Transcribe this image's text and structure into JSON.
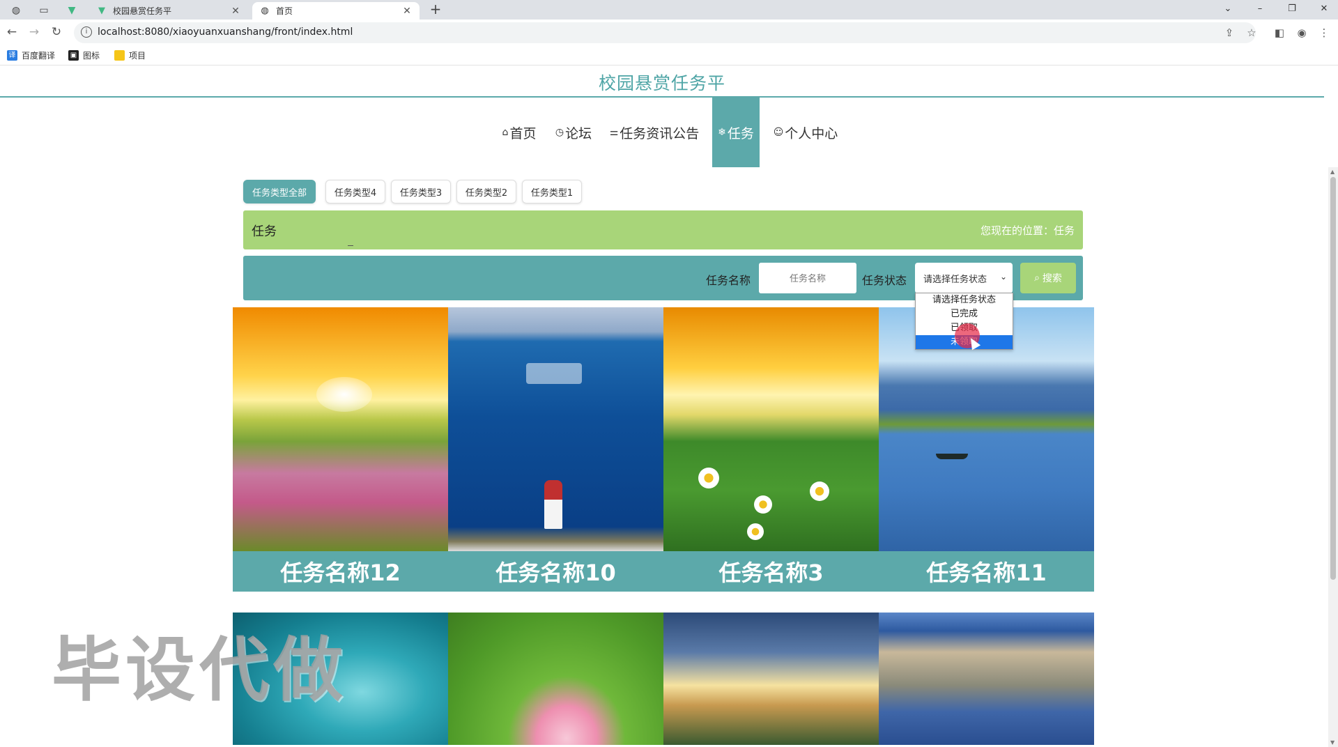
{
  "browser": {
    "tabs": [
      {
        "label": "校园悬赏任务平",
        "icon": "vue-logo-icon",
        "active": false
      },
      {
        "label": "首页",
        "icon": "globe-icon",
        "active": true
      }
    ],
    "url": "localhost:8080/xiaoyuanxuanshang/front/index.html",
    "bookmarks": [
      {
        "label": "百度翻译",
        "color": "#2a7de1"
      },
      {
        "label": "图标",
        "color": "#222222"
      },
      {
        "label": "项目",
        "color": "#f5c518"
      }
    ]
  },
  "site": {
    "title": "校园悬赏任务平"
  },
  "nav": [
    {
      "label": "首页",
      "icon": "⌂"
    },
    {
      "label": "论坛",
      "icon": "◷"
    },
    {
      "label": "任务资讯公告",
      "icon": "⚌"
    },
    {
      "label": "任务",
      "icon": "❄"
    },
    {
      "label": "个人中心",
      "icon": "☺"
    }
  ],
  "filters": [
    "任务类型全部",
    "任务类型4",
    "任务类型3",
    "任务类型2",
    "任务类型1"
  ],
  "breadcrumb": {
    "current": "任务",
    "position": "您现在的位置：任务"
  },
  "search": {
    "name_label": "任务名称",
    "name_placeholder": "任务名称",
    "status_label": "任务状态",
    "status_selected": "请选择任务状态",
    "button": "搜索",
    "options": [
      "请选择任务状态",
      "已完成",
      "已领取",
      "未领取"
    ]
  },
  "tasks": [
    {
      "name": "任务名称12"
    },
    {
      "name": "任务名称10"
    },
    {
      "name": "任务名称3"
    },
    {
      "name": "任务名称11"
    }
  ],
  "watermark": "毕设代做",
  "colors": {
    "primary": "#5ca9aa",
    "accent": "#a8d579",
    "highlight": "#1e77e8"
  }
}
